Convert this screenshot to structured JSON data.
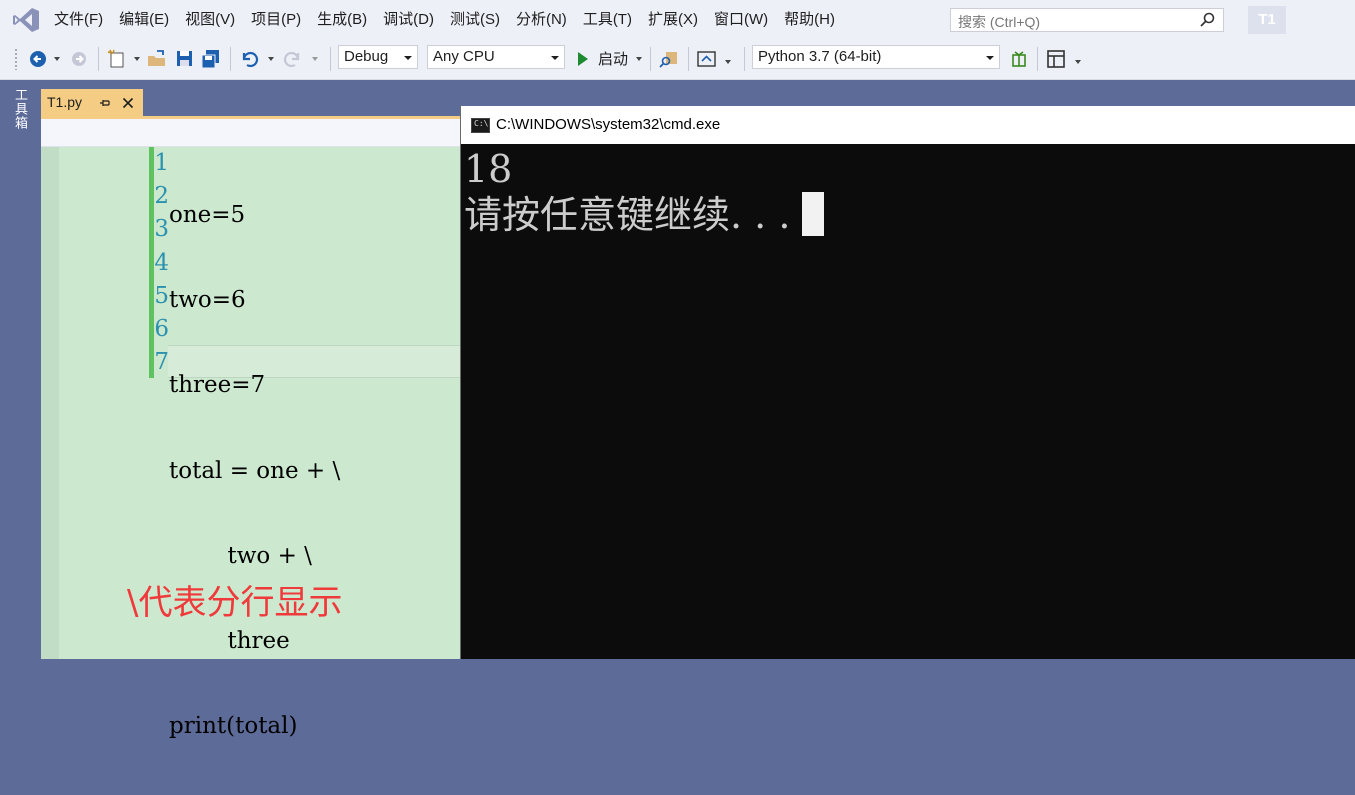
{
  "menubar": {
    "items": [
      "文件(F)",
      "编辑(E)",
      "视图(V)",
      "项目(P)",
      "生成(B)",
      "调试(D)",
      "测试(S)",
      "分析(N)",
      "工具(T)",
      "扩展(X)",
      "窗口(W)",
      "帮助(H)"
    ],
    "search_placeholder": "搜索 (Ctrl+Q)",
    "project_badge": "T1"
  },
  "toolbar": {
    "configuration": "Debug",
    "platform": "Any CPU",
    "start_label": "启动",
    "environment": "Python 3.7 (64-bit)"
  },
  "sidebar": {
    "toolbox_label": "工具箱"
  },
  "editor": {
    "tab_name": "T1.py",
    "line_numbers": [
      "1",
      "2",
      "3",
      "4",
      "5",
      "6",
      "7"
    ],
    "code_lines": [
      "one=5",
      "two=6",
      "three=7",
      "total = one + \\",
      "        two + \\",
      "        three",
      "print(total)"
    ],
    "annotation": "\\代表分行显示"
  },
  "console": {
    "title": "C:\\WINDOWS\\system32\\cmd.exe",
    "icon_text": "C:\\",
    "output_lines": [
      "18",
      "请按任意键继续. . ."
    ]
  },
  "colors": {
    "accent": "#5d6b99",
    "tab_active": "#f5cc84",
    "editor_bg": "#cce8cf",
    "line_number": "#2b91af",
    "annotation": "#f0393a",
    "console_bg": "#0c0c0c"
  }
}
